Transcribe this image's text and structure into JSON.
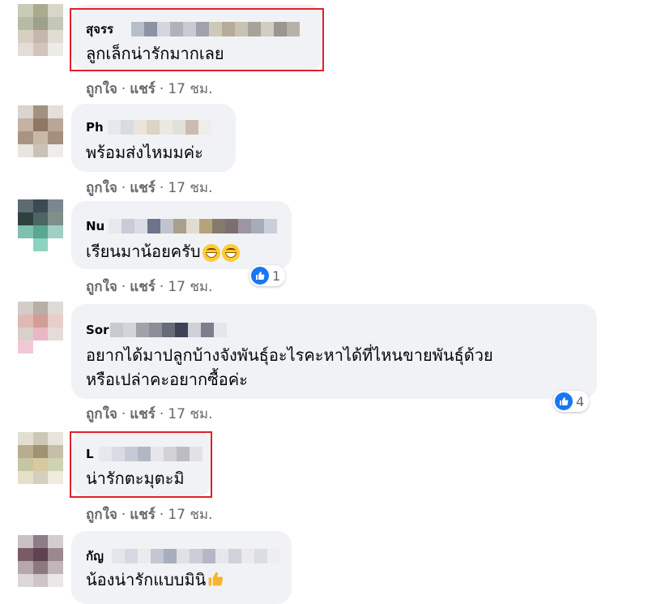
{
  "comments": [
    {
      "author": "สุจรร",
      "text": "ลูกเล็กน่ารักมากเลย",
      "like_label": "ถูกใจ",
      "share_label": "แชร์",
      "time": "17 ชม."
    },
    {
      "author": "Ph",
      "text": "พร้อมส่งไหมมค่ะ",
      "like_label": "ถูกใจ",
      "share_label": "แชร์",
      "time": "17 ชม."
    },
    {
      "author": "Nu",
      "text": "เรียนมาน้อยครับ",
      "like_label": "ถูกใจ",
      "share_label": "แชร์",
      "time": "17 ชม.",
      "reaction_count": "1",
      "emoji": "grinning-face-icon"
    },
    {
      "author": "Sor",
      "text_line1": "อยากได้มาปลูกบ้างจังพันธุ์อะไรคะหาได้ที่ไหนขายพันธุ์ด้วย",
      "text_line2": "หรือเปล่าคะอยากซื้อค่ะ",
      "like_label": "ถูกใจ",
      "share_label": "แชร์",
      "time": "17 ชม.",
      "reaction_count": "4"
    },
    {
      "author": "L",
      "text": "น่ารักตะมุตะมิ",
      "like_label": "ถูกใจ",
      "share_label": "แชร์",
      "time": "17 ชม."
    },
    {
      "author": "กัญ",
      "text": "น้องน่ารักแบบมินิ",
      "emoji": "thumbs-up-icon"
    }
  ],
  "separator": "·",
  "colors": {
    "bubble": "#f0f2f5",
    "meta_text": "#65676b",
    "like_blue": "#1877f2",
    "highlight": "#e0202a"
  }
}
